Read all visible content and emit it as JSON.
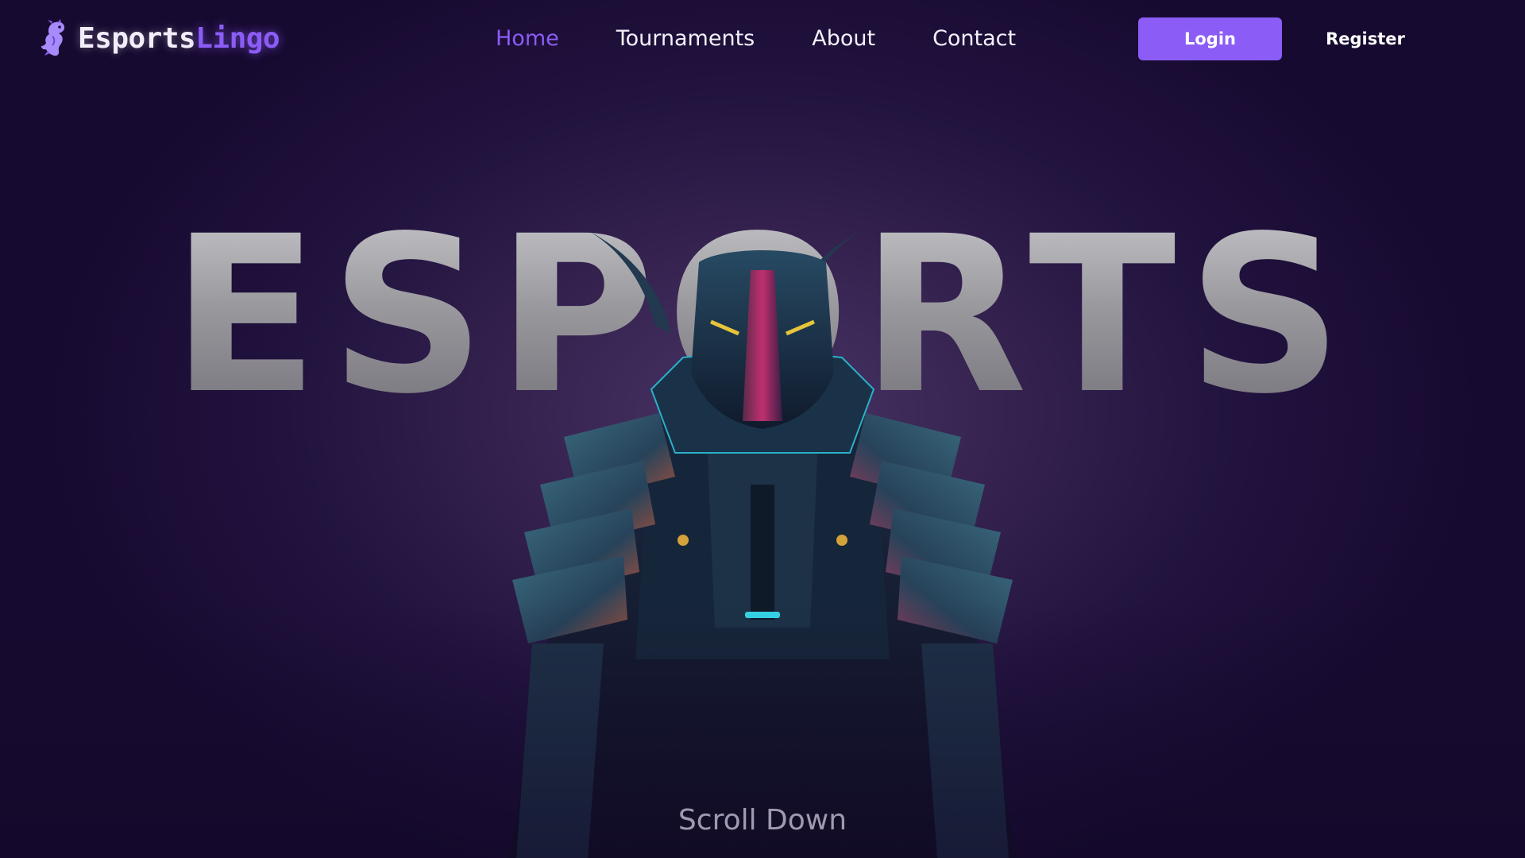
{
  "brand": {
    "name_part1": "Esports",
    "name_part2": "Lingo",
    "logo_icon": "dragon-mascot-icon",
    "accent_color": "#8b5cf6"
  },
  "nav": {
    "links": [
      {
        "label": "Home",
        "active": true
      },
      {
        "label": "Tournaments",
        "active": false
      },
      {
        "label": "About",
        "active": false
      },
      {
        "label": "Contact",
        "active": false
      }
    ],
    "login_label": "Login",
    "register_label": "Register"
  },
  "hero": {
    "headline": "ESPORTS",
    "figure": "armored-horned-warrior-illustration",
    "scroll_label": "Scroll Down"
  },
  "colors": {
    "background": "#1a0d33",
    "text": "#ffffff",
    "active_link": "#8b5cf6"
  }
}
